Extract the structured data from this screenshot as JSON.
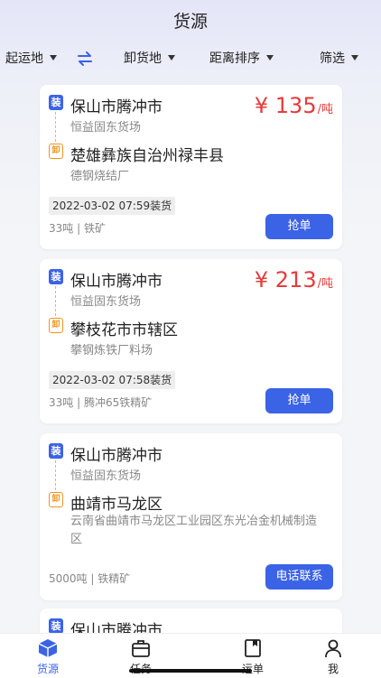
{
  "header": {
    "title": "货源"
  },
  "filters": {
    "origin": "起运地",
    "destination": "卸货地",
    "sort": "距离排序",
    "filter": "筛选"
  },
  "icons": {
    "load": "装",
    "unload": "卸"
  },
  "colors": {
    "accent": "#3b63e6",
    "price": "#e83a3a",
    "unload_badge": "#f0941e"
  },
  "cards": [
    {
      "origin_city": "保山市腾冲市",
      "origin_site": "恒益固东货场",
      "dest_city": "楚雄彝族自治州禄丰县",
      "dest_site": "德钢烧结厂",
      "price": "¥ 135",
      "price_unit": "/吨",
      "load_time": "2022-03-02 07:59装货",
      "cargo": "33吨 | 铁矿",
      "action": "抢单"
    },
    {
      "origin_city": "保山市腾冲市",
      "origin_site": "恒益固东货场",
      "dest_city": "攀枝花市市辖区",
      "dest_site": "攀钢炼铁厂料场",
      "price": "¥ 213",
      "price_unit": "/吨",
      "load_time": "2022-03-02 07:58装货",
      "cargo": "33吨 | 腾冲65铁精矿",
      "action": "抢单"
    },
    {
      "origin_city": "保山市腾冲市",
      "origin_site": "恒益固东货场",
      "dest_city": "曲靖市马龙区",
      "dest_site": "云南省曲靖市马龙区工业园区东光冶金机械制造区",
      "cargo": "5000吨 | 铁精矿",
      "action": "电话联系"
    },
    {
      "origin_city": "保山市腾冲市"
    }
  ],
  "tabbar": {
    "items": [
      {
        "label": "货源",
        "icon": "cube-icon",
        "active": true
      },
      {
        "label": "任务",
        "icon": "briefcase-icon",
        "active": false
      },
      {
        "label": "运单",
        "icon": "waybill-icon",
        "active": false
      },
      {
        "label": "我",
        "icon": "person-icon",
        "active": false
      }
    ]
  }
}
